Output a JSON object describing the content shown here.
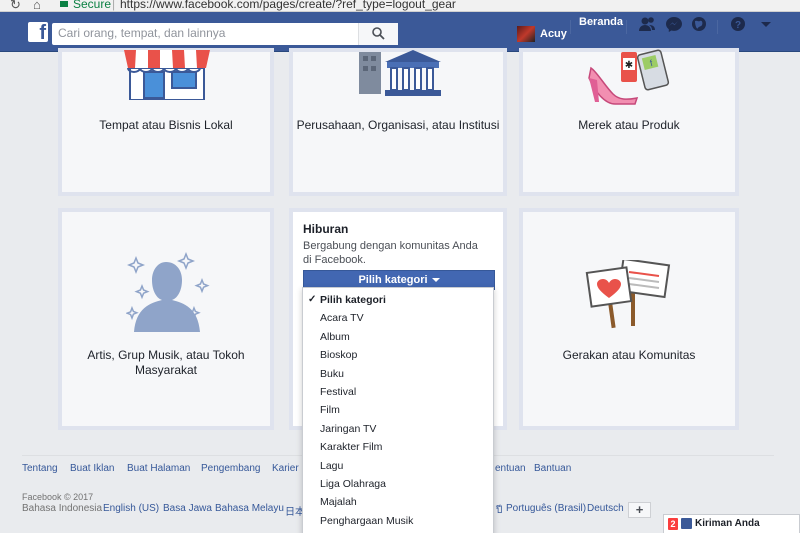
{
  "browser": {
    "secure_label": "Secure",
    "url": "https://www.facebook.com/pages/create/?ref_type=logout_gear"
  },
  "header": {
    "logo_letter": "f",
    "search_placeholder": "Cari orang, tempat, dan lainnya",
    "profile_name": "Acuy",
    "home_label": "Beranda",
    "icons": [
      "friend-requests-icon",
      "messages-icon",
      "notifications-icon",
      "help-icon",
      "account-menu-icon"
    ]
  },
  "cards": [
    {
      "label": "Tempat atau Bisnis Lokal",
      "icon": "storefront-icon"
    },
    {
      "label": "Perusahaan, Organisasi, atau Institusi",
      "icon": "buildings-icon"
    },
    {
      "label": "Merek atau Produk",
      "icon": "products-icon"
    },
    {
      "label": "Artis, Grup Musik, atau Tokoh Masyarakat",
      "icon": "artist-silhouette-icon"
    },
    {
      "label": "Gerakan atau Komunitas",
      "icon": "protest-signs-icon"
    }
  ],
  "hiburan": {
    "title": "Hiburan",
    "description": "Bergabung dengan komunitas Anda di Facebook.",
    "button_label": "Pilih kategori"
  },
  "dropdown": {
    "items": [
      "Pilih kategori",
      "Acara TV",
      "Album",
      "Bioskop",
      "Buku",
      "Festival",
      "Film",
      "Jaringan TV",
      "Karakter Film",
      "Lagu",
      "Liga Olahraga",
      "Majalah",
      "Penghargaan Musik"
    ],
    "selected_index": 0
  },
  "footer": {
    "links": [
      "Tentang",
      "Buat Iklan",
      "Buat Halaman",
      "Pengembang",
      "Karier",
      "entuan",
      "Bantuan"
    ],
    "copyright": "Facebook © 2017",
    "languages": [
      "Bahasa Indonesia",
      "English (US)",
      "Basa Jawa",
      "Bahasa Melayu",
      "日本",
      "ปี",
      "Português (Brasil)",
      "Deutsch"
    ],
    "plus_label": "+"
  },
  "chat": {
    "badge": "2",
    "label": "Kiriman Anda"
  },
  "colors": {
    "fb_blue": "#3b5998",
    "button_blue": "#4267b2",
    "link_blue": "#365899"
  }
}
